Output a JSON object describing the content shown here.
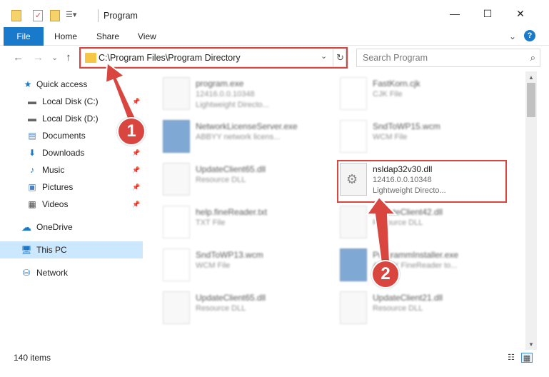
{
  "window": {
    "title": "Program",
    "minimize": "—",
    "maximize": "☐",
    "close": "✕"
  },
  "ribbon": {
    "file": "File",
    "tabs": [
      "Home",
      "Share",
      "View"
    ],
    "expand": "⌄",
    "help": "?"
  },
  "nav": {
    "back": "←",
    "forward": "→",
    "recent": "⌄",
    "up": "↑",
    "address": "C:\\Program Files\\Program Directory",
    "dropdown": "⌄",
    "refresh": "↻",
    "search_placeholder": "Search Program",
    "search_icon": "⌕"
  },
  "sidebar": {
    "items": [
      {
        "label": "Quick access",
        "icon": "star-icon"
      },
      {
        "label": "Local Disk (C:)",
        "icon": "drive-icon"
      },
      {
        "label": "Local Disk (D:)",
        "icon": "drive-icon"
      },
      {
        "label": "Documents",
        "icon": "documents-icon"
      },
      {
        "label": "Downloads",
        "icon": "download-icon"
      },
      {
        "label": "Music",
        "icon": "music-icon"
      },
      {
        "label": "Pictures",
        "icon": "pictures-icon"
      },
      {
        "label": "Videos",
        "icon": "videos-icon"
      },
      {
        "label": "OneDrive",
        "icon": "cloud-icon"
      },
      {
        "label": "This PC",
        "icon": "computer-icon"
      },
      {
        "label": "Network",
        "icon": "network-icon"
      }
    ]
  },
  "files": [
    {
      "name": "program.exe",
      "meta1": "12416.0.0.10348",
      "meta2": "Lightweight Directo..."
    },
    {
      "name": "FastKorn.cjk",
      "meta1": "CJK File",
      "meta2": ""
    },
    {
      "name": "NetworkLicenseServer.exe",
      "meta1": "ABBYY network licens...",
      "meta2": ""
    },
    {
      "name": "SndToWP15.wcm",
      "meta1": "WCM File",
      "meta2": ""
    },
    {
      "name": "UpdateClient65.dll",
      "meta1": "Resource DLL",
      "meta2": ""
    },
    {
      "name": "nsldap32v30.dll",
      "meta1": "12416.0.0.10348",
      "meta2": "Lightweight Directo..."
    },
    {
      "name": "help.fineReader.txt",
      "meta1": "TXT File",
      "meta2": ""
    },
    {
      "name": "UpdateClient42.dll",
      "meta1": "Resource DLL",
      "meta2": ""
    },
    {
      "name": "SndToWP13.wcm",
      "meta1": "WCM File",
      "meta2": ""
    },
    {
      "name": "ProgrammInstaller.exe",
      "meta1": "ABBYY FineReader to...",
      "meta2": ""
    },
    {
      "name": "UpdateClient65.dll",
      "meta1": "Resource DLL",
      "meta2": ""
    },
    {
      "name": "UpdateClient21.dll",
      "meta1": "Resource DLL",
      "meta2": ""
    }
  ],
  "status": {
    "item_count": "140 items"
  },
  "annotations": {
    "badge1": "1",
    "badge2": "2",
    "color": "#d9453f"
  }
}
